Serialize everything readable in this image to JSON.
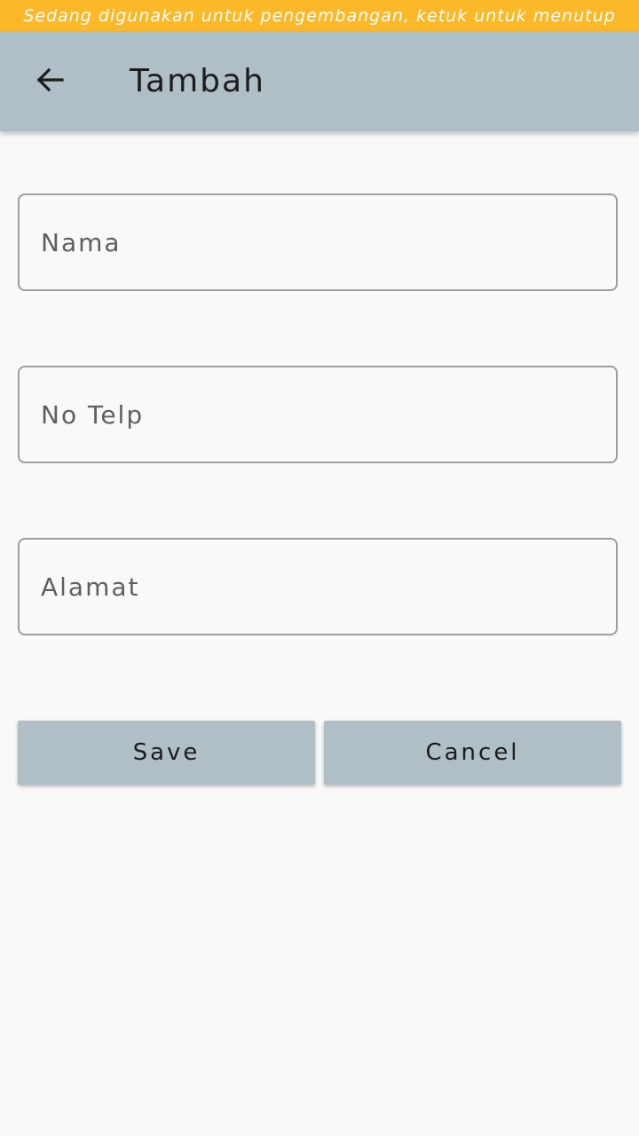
{
  "dev_banner": {
    "text": "Sedang digunakan untuk pengembangan, ketuk untuk menutup",
    "color": "#fbb829"
  },
  "appbar": {
    "title": "Tambah",
    "back_icon": "arrow-back-icon",
    "color": "#b0bec5"
  },
  "form": {
    "nama_placeholder": "Nama",
    "telp_placeholder": "No Telp",
    "alamat_placeholder": "Alamat"
  },
  "actions": {
    "save_label": "Save",
    "cancel_label": "Cancel"
  }
}
